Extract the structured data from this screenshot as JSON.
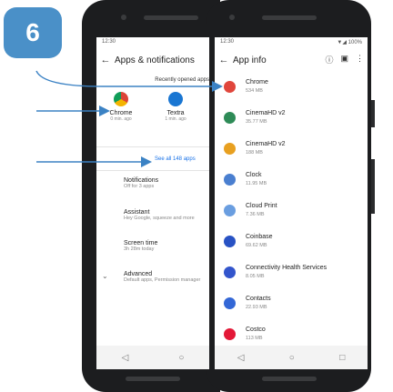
{
  "badge": {
    "number": "6"
  },
  "left_screen": {
    "time": "12:30",
    "title": "Apps & notifications",
    "recently_opened": "Recently opened apps",
    "recent_apps": [
      {
        "name": "Chrome",
        "time": "0 min. ago"
      },
      {
        "name": "Textra",
        "time": "1 min. ago"
      }
    ],
    "see_all": "See all 148 apps",
    "settings": [
      {
        "title": "Notifications",
        "sub": "Off for 3 apps"
      },
      {
        "title": "Assistant",
        "sub": "Hey Google, squeeze and more"
      },
      {
        "title": "Screen time",
        "sub": "3h 28m today"
      },
      {
        "title": "Advanced",
        "sub": "Default apps, Permission manager"
      }
    ]
  },
  "right_screen": {
    "time": "12:30",
    "battery": "100%",
    "title": "App info",
    "apps": [
      {
        "name": "Chrome",
        "size": "534 MB",
        "color": "#e0463c"
      },
      {
        "name": "CinemaHD v2",
        "size": "35.77 MB",
        "color": "#2e8b57"
      },
      {
        "name": "CinemaHD v2",
        "size": "188 MB",
        "color": "#e8a020"
      },
      {
        "name": "Clock",
        "size": "11.95 MB",
        "color": "#4a7fd0"
      },
      {
        "name": "Cloud Print",
        "size": "7.36 MB",
        "color": "#6a9ee0"
      },
      {
        "name": "Coinbase",
        "size": "69.62 MB",
        "color": "#2852c4"
      },
      {
        "name": "Connectivity Health Services",
        "size": "8.05 MB",
        "color": "#3355cc"
      },
      {
        "name": "Contacts",
        "size": "22.93 MB",
        "color": "#3367d6"
      },
      {
        "name": "Costco",
        "size": "113 MB",
        "color": "#e31837"
      }
    ]
  }
}
